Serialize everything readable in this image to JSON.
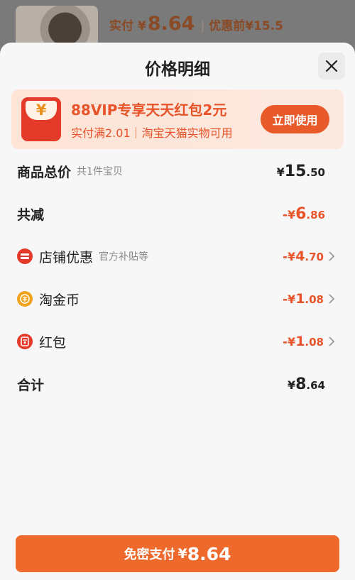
{
  "background": {
    "paid_label": "实付",
    "currency": "¥",
    "paid_amount": "8.64",
    "original_label": "优惠前",
    "original_amount": "¥15.5"
  },
  "sheet": {
    "title": "价格明细"
  },
  "promo": {
    "title": "88VIP专享天天红包2元",
    "subtitle": "实付满2.01｜淘宝天猫实物可用",
    "button": "立即使用",
    "coin_symbol": "¥"
  },
  "rows": {
    "total_goods": {
      "label": "商品总价",
      "note": "共1件宝贝",
      "currency": "¥",
      "int": "15",
      "dec": ".50"
    },
    "total_discount": {
      "label": "共减",
      "sign": "-",
      "currency": "¥",
      "int": "6",
      "dec": ".86"
    },
    "store_discount": {
      "label": "店铺优惠",
      "note": "官方补贴等",
      "sign": "-",
      "currency": "¥",
      "int": "4",
      "dec": ".70"
    },
    "taojinbi": {
      "label": "淘金币",
      "sign": "-",
      "currency": "¥",
      "int": "1",
      "dec": ".08"
    },
    "red_packet": {
      "label": "红包",
      "sign": "-",
      "currency": "¥",
      "int": "1",
      "dec": ".08"
    },
    "sum": {
      "label": "合计",
      "currency": "¥",
      "int": "8",
      "dec": ".64"
    }
  },
  "pay_button": {
    "label": "免密支付",
    "currency": "¥",
    "amount": "8.64"
  },
  "colors": {
    "accent": "#e8542a",
    "pay_button": "#ed6a2c",
    "store_icon": "#e43a2a",
    "coin_icon": "#f0a41e",
    "red_packet_icon": "#e43a2a"
  },
  "icons": [
    "close-icon",
    "red-packet-icon",
    "store-discount-icon",
    "gold-coin-icon",
    "chevron-right-icon"
  ]
}
